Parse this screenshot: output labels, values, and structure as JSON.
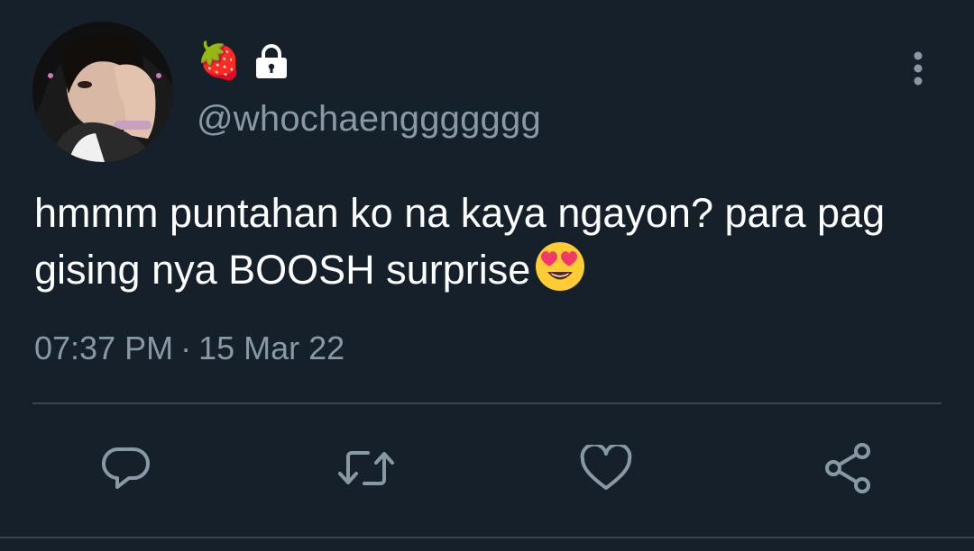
{
  "tweet": {
    "display_name_emoji": "🍓",
    "protected_icon": "lock-icon",
    "handle": "@whochaenggggggg",
    "text": "hmmm puntahan ko na kaya ngayon? para pag gising nya BOOSH surprise",
    "text_emoji": "heart-eyes-emoji",
    "time": "07:37 PM",
    "separator": "·",
    "date": "15 Mar 22"
  },
  "actions": [
    {
      "icon": "reply-icon"
    },
    {
      "icon": "retweet-icon"
    },
    {
      "icon": "like-icon"
    },
    {
      "icon": "share-icon"
    }
  ],
  "colors": {
    "background": "#15202b",
    "text": "#ffffff",
    "secondary_text": "#8899a6",
    "divider": "#38444d"
  }
}
